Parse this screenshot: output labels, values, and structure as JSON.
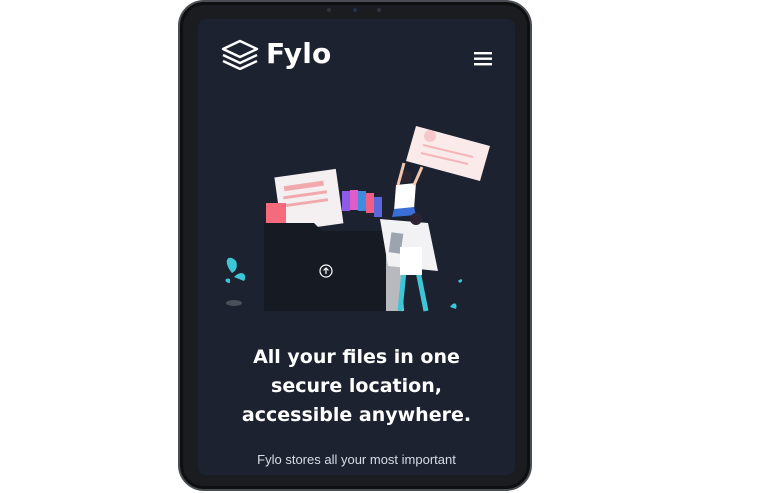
{
  "app": {
    "brand_name": "Fylo",
    "logo_icon": "stacked-layers-icon",
    "menu_icon": "hamburger-menu-icon"
  },
  "hero": {
    "illustration": "file-folder-illustration",
    "headline_line1": "All your files in one",
    "headline_line2": "secure location,",
    "headline_line3": "accessible anywhere.",
    "description": "Fylo stores all your most important"
  },
  "colors": {
    "background": "#1c2230",
    "text": "#ffffff",
    "accent_cyan": "#3ec6d7",
    "accent_pink": "#f4727b"
  }
}
